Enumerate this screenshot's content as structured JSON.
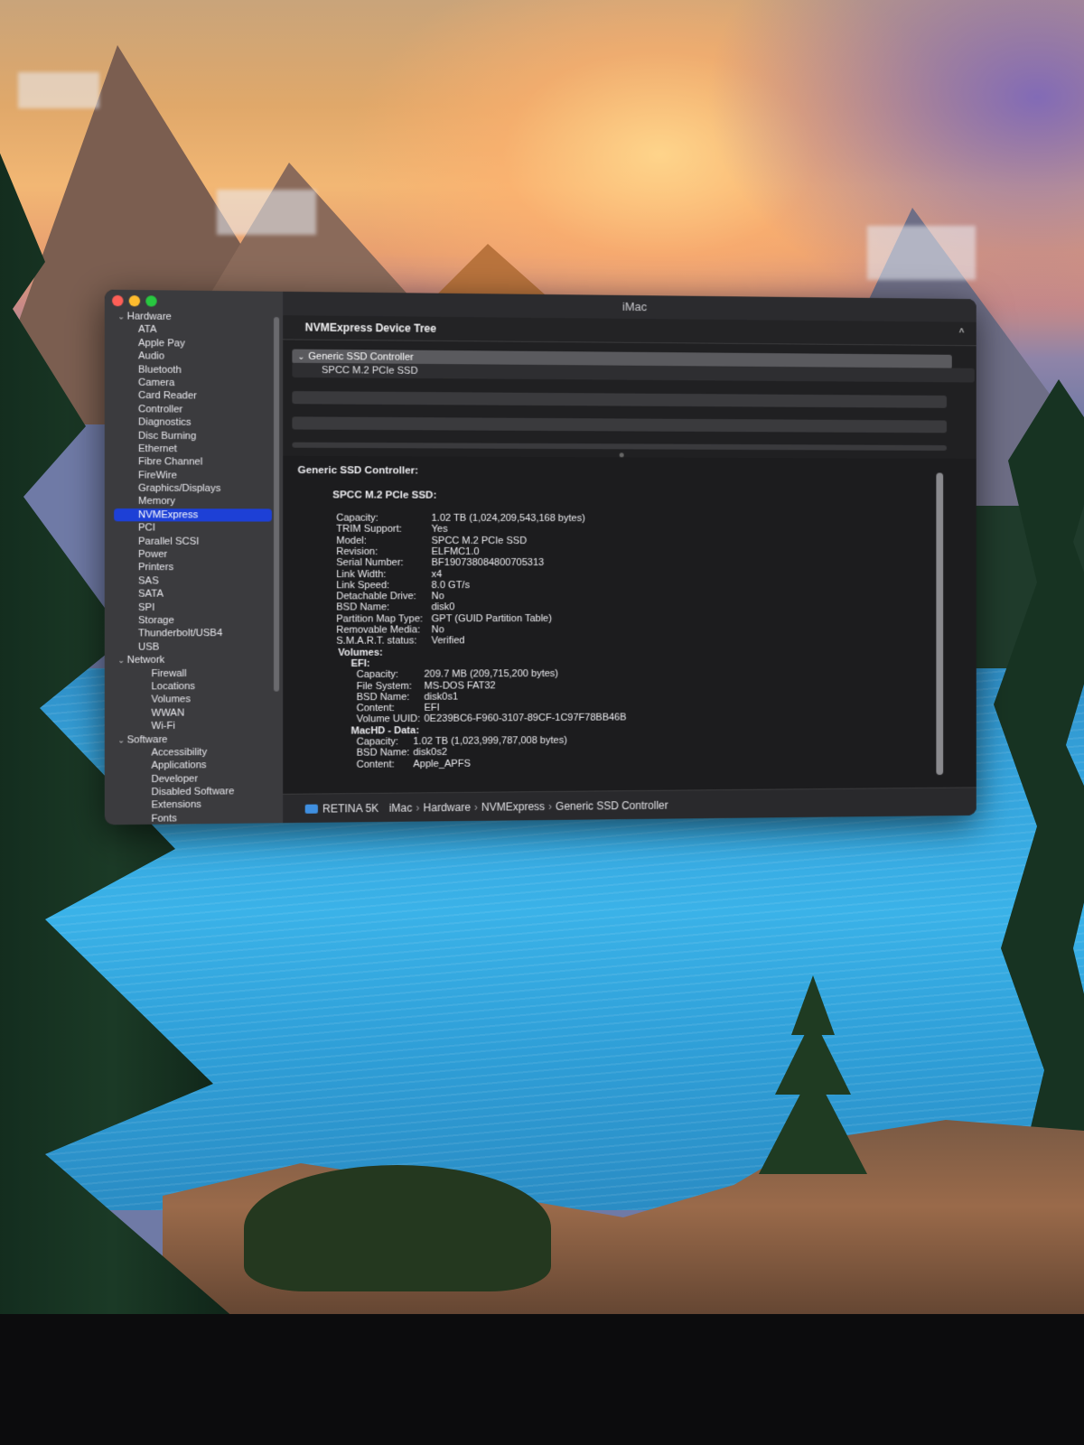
{
  "window": {
    "title": "iMac"
  },
  "sidebar": {
    "items": [
      {
        "label": "Hardware",
        "level": "category",
        "expanded": true
      },
      {
        "label": "ATA",
        "level": "item"
      },
      {
        "label": "Apple Pay",
        "level": "item"
      },
      {
        "label": "Audio",
        "level": "item"
      },
      {
        "label": "Bluetooth",
        "level": "item"
      },
      {
        "label": "Camera",
        "level": "item"
      },
      {
        "label": "Card Reader",
        "level": "item"
      },
      {
        "label": "Controller",
        "level": "item"
      },
      {
        "label": "Diagnostics",
        "level": "item"
      },
      {
        "label": "Disc Burning",
        "level": "item"
      },
      {
        "label": "Ethernet",
        "level": "item"
      },
      {
        "label": "Fibre Channel",
        "level": "item"
      },
      {
        "label": "FireWire",
        "level": "item"
      },
      {
        "label": "Graphics/Displays",
        "level": "item"
      },
      {
        "label": "Memory",
        "level": "item"
      },
      {
        "label": "NVMExpress",
        "level": "item",
        "selected": true
      },
      {
        "label": "PCI",
        "level": "item"
      },
      {
        "label": "Parallel SCSI",
        "level": "item"
      },
      {
        "label": "Power",
        "level": "item"
      },
      {
        "label": "Printers",
        "level": "item"
      },
      {
        "label": "SAS",
        "level": "item"
      },
      {
        "label": "SATA",
        "level": "item"
      },
      {
        "label": "SPI",
        "level": "item"
      },
      {
        "label": "Storage",
        "level": "item"
      },
      {
        "label": "Thunderbolt/USB4",
        "level": "item"
      },
      {
        "label": "USB",
        "level": "item"
      },
      {
        "label": "Network",
        "level": "category",
        "expanded": true
      },
      {
        "label": "Firewall",
        "level": "sub"
      },
      {
        "label": "Locations",
        "level": "sub"
      },
      {
        "label": "Volumes",
        "level": "sub"
      },
      {
        "label": "WWAN",
        "level": "sub"
      },
      {
        "label": "Wi-Fi",
        "level": "sub"
      },
      {
        "label": "Software",
        "level": "category",
        "expanded": true
      },
      {
        "label": "Accessibility",
        "level": "sub"
      },
      {
        "label": "Applications",
        "level": "sub"
      },
      {
        "label": "Developer",
        "level": "sub"
      },
      {
        "label": "Disabled Software",
        "level": "sub"
      },
      {
        "label": "Extensions",
        "level": "sub"
      },
      {
        "label": "Fonts",
        "level": "sub"
      }
    ],
    "selected_color": "#1d40d6"
  },
  "tree": {
    "header": "NVMExpress Device Tree",
    "rows": [
      {
        "label": "Generic SSD Controller",
        "expanded": true
      },
      {
        "label": "SPCC M.2 PCIe SSD"
      }
    ]
  },
  "detail": {
    "controller_heading": "Generic SSD Controller:",
    "device_heading": "SPCC M.2 PCIe SSD:",
    "properties": [
      {
        "key": "Capacity:",
        "value": "1.02 TB (1,024,209,543,168 bytes)"
      },
      {
        "key": "TRIM Support:",
        "value": "Yes"
      },
      {
        "key": "Model:",
        "value": "SPCC M.2 PCIe SSD"
      },
      {
        "key": "Revision:",
        "value": "ELFMC1.0"
      },
      {
        "key": "Serial Number:",
        "value": "BF190738084800705313"
      },
      {
        "key": "Link Width:",
        "value": "x4"
      },
      {
        "key": "Link Speed:",
        "value": "8.0 GT/s"
      },
      {
        "key": "Detachable Drive:",
        "value": "No"
      },
      {
        "key": "BSD Name:",
        "value": "disk0"
      },
      {
        "key": "Partition Map Type:",
        "value": "GPT (GUID Partition Table)"
      },
      {
        "key": "Removable Media:",
        "value": "No"
      },
      {
        "key": "S.M.A.R.T. status:",
        "value": "Verified"
      }
    ],
    "volumes_label": "Volumes:",
    "efi": {
      "label": "EFI:",
      "properties": [
        {
          "key": "Capacity:",
          "value": "209.7 MB (209,715,200 bytes)"
        },
        {
          "key": "File System:",
          "value": "MS-DOS FAT32"
        },
        {
          "key": "BSD Name:",
          "value": "disk0s1"
        },
        {
          "key": "Content:",
          "value": "EFI"
        },
        {
          "key": "Volume UUID:",
          "value": "0E239BC6-F960-3107-89CF-1C97F78BB46B"
        }
      ]
    },
    "machd": {
      "label": "MacHD - Data:",
      "properties": [
        {
          "key": "Capacity:",
          "value": "1.02 TB (1,023,999,787,008 bytes)"
        },
        {
          "key": "BSD Name:",
          "value": "disk0s2"
        },
        {
          "key": "Content:",
          "value": "Apple_APFS"
        }
      ]
    }
  },
  "pathbar": {
    "icon": "monitor-icon",
    "display": "RETINA 5K",
    "crumbs": [
      "iMac",
      "Hardware",
      "NVMExpress",
      "Generic SSD Controller"
    ]
  }
}
